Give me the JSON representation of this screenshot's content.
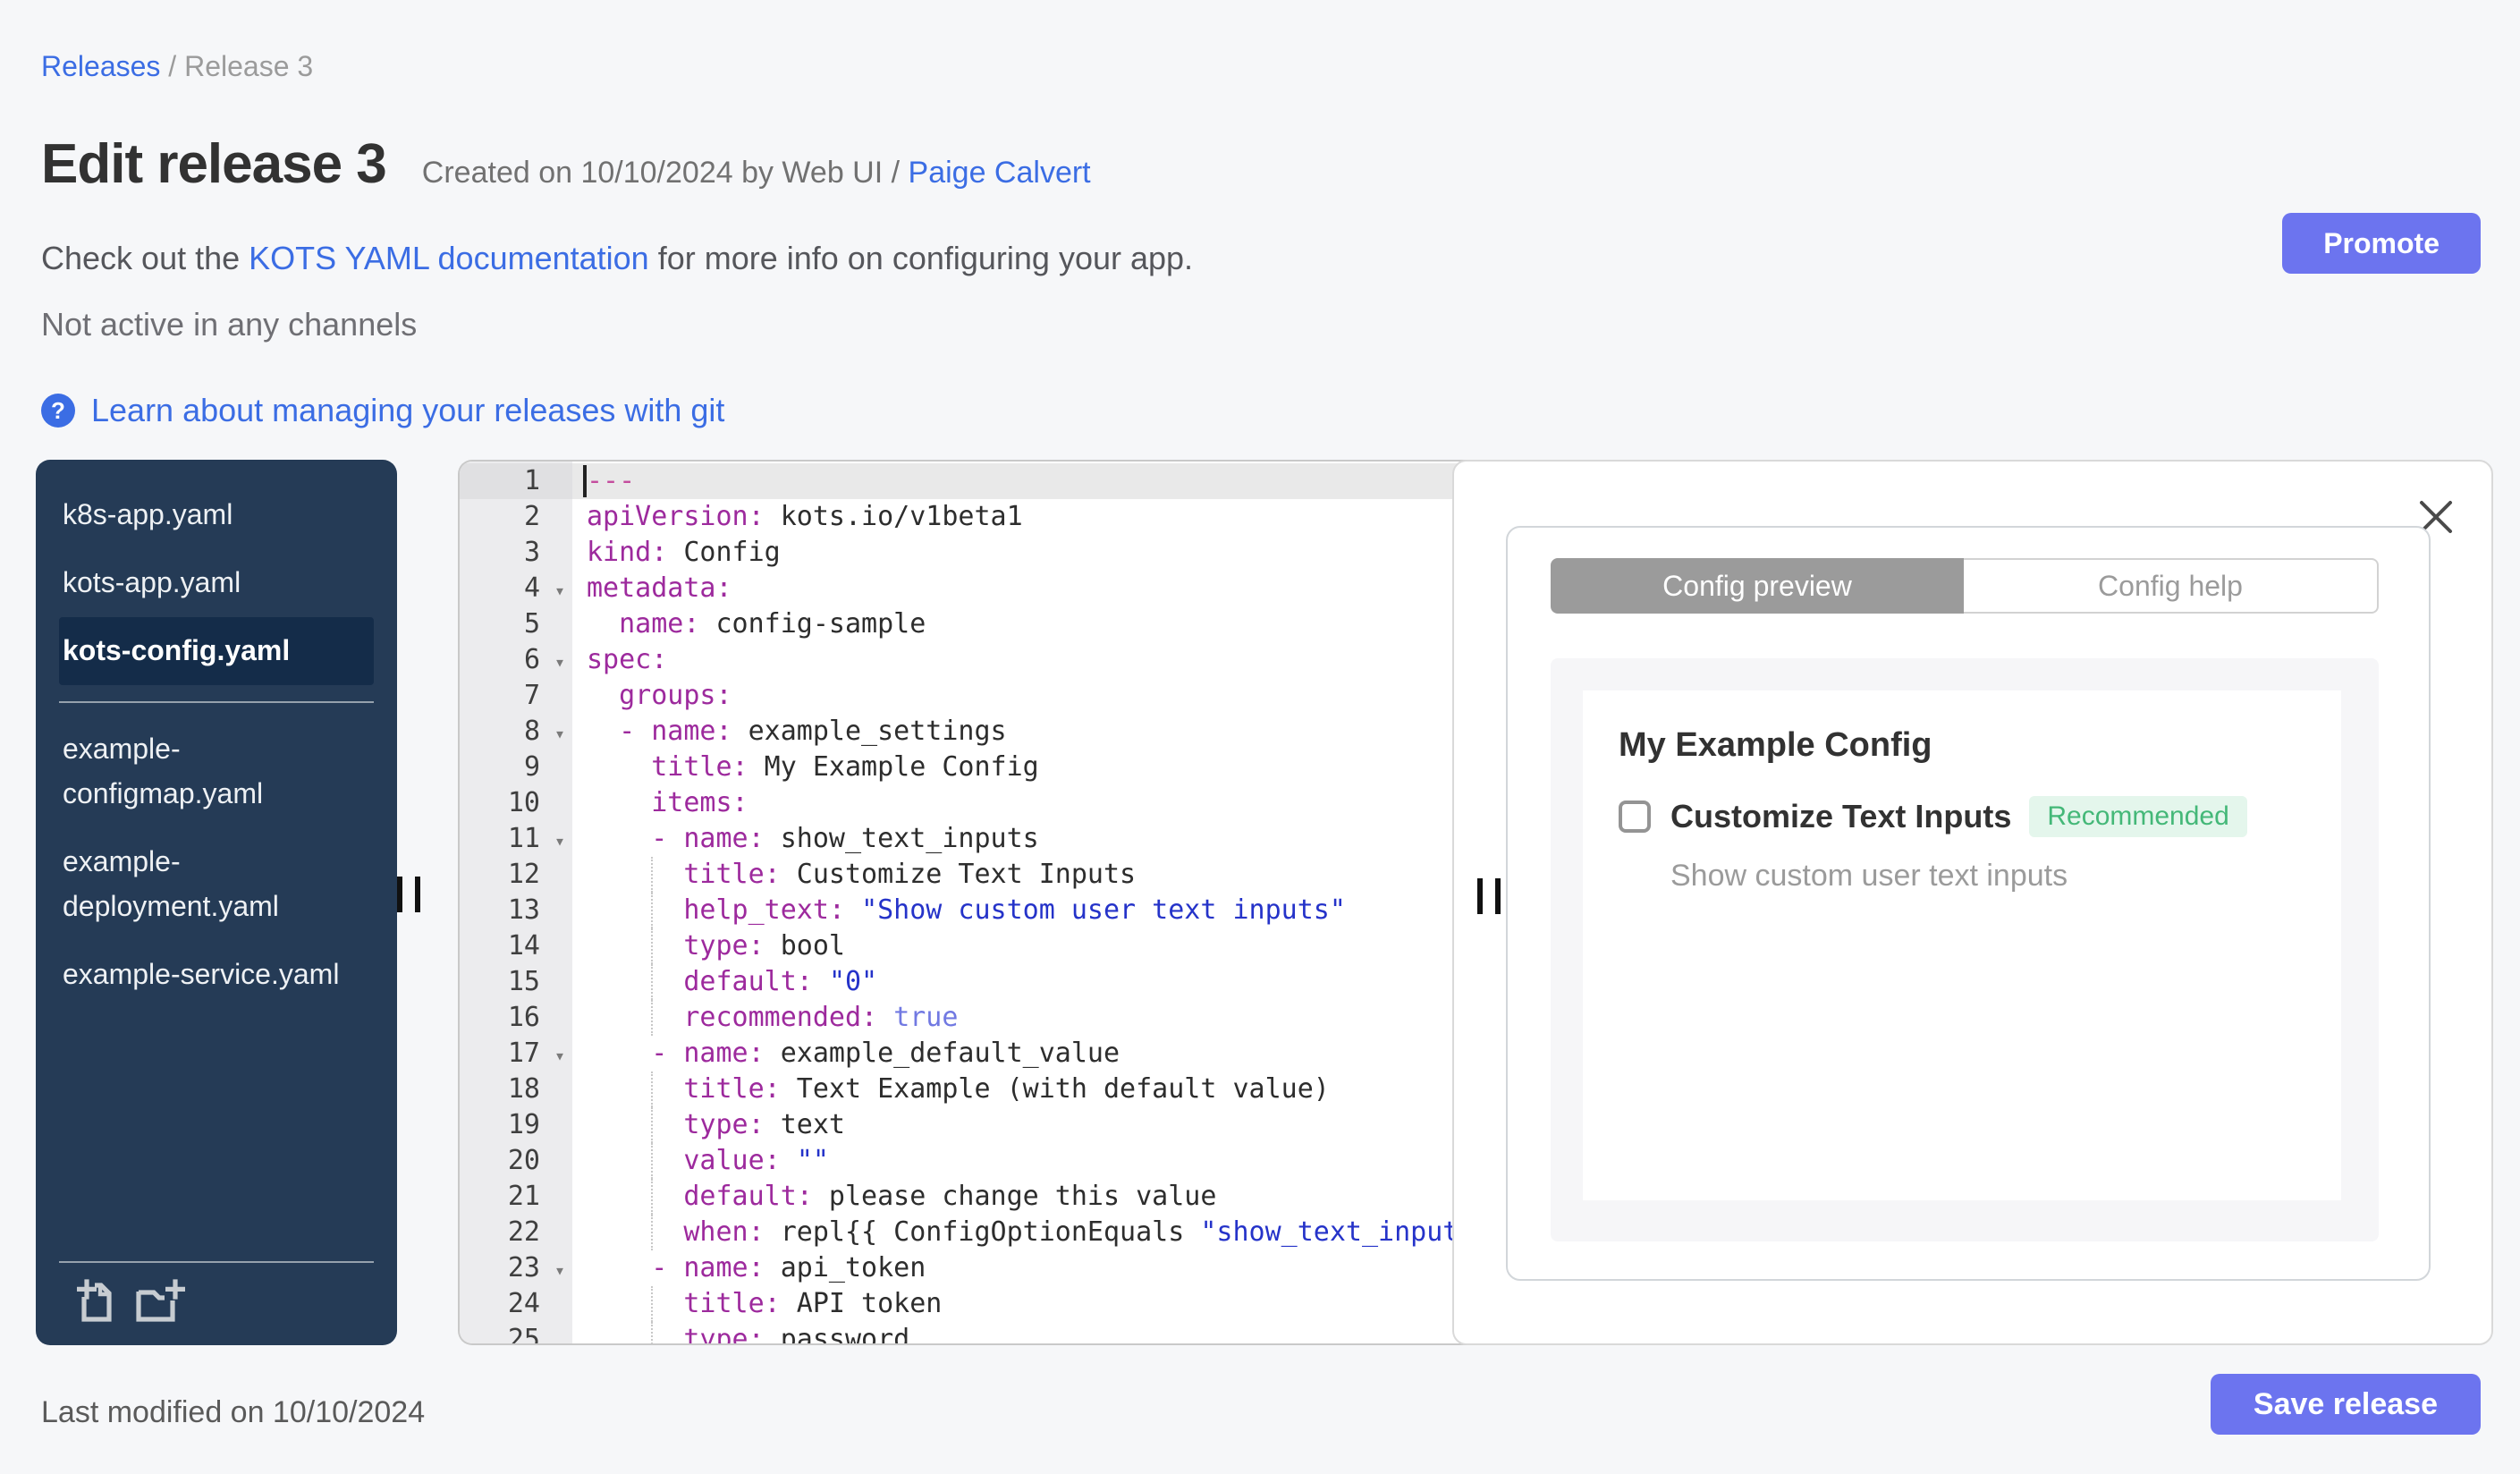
{
  "breadcrumb": {
    "link": "Releases",
    "separator": " / ",
    "current": "Release 3"
  },
  "header": {
    "title": "Edit release 3",
    "created_prefix": "Created on 10/10/2024 by Web UI / ",
    "author_link": "Paige Calvert"
  },
  "promote_label": "Promote",
  "docs_line": {
    "prefix": "Check out the ",
    "link": "KOTS YAML documentation",
    "suffix": " for more info on configuring your app."
  },
  "status_line": "Not active in any channels",
  "git_link": {
    "icon": "?",
    "label": "Learn about managing your releases with git"
  },
  "file_tree": {
    "top": [
      {
        "name": "k8s-app.yaml",
        "selected": false
      },
      {
        "name": "kots-app.yaml",
        "selected": false
      },
      {
        "name": "kots-config.yaml",
        "selected": true
      }
    ],
    "bottom": [
      {
        "name": "example-configmap.yaml",
        "selected": false
      },
      {
        "name": "example-deployment.yaml",
        "selected": false
      },
      {
        "name": "example-service.yaml",
        "selected": false
      }
    ],
    "icons": [
      "add-file-icon",
      "add-folder-icon"
    ]
  },
  "editor": {
    "lines": [
      {
        "num": 1,
        "fold": false,
        "guide": false,
        "active": true,
        "segments": [
          [
            "td",
            "---"
          ]
        ]
      },
      {
        "num": 2,
        "fold": false,
        "guide": false,
        "segments": [
          [
            "tk",
            "apiVersion:"
          ],
          [
            "tv",
            " kots.io/v1beta1"
          ]
        ]
      },
      {
        "num": 3,
        "fold": false,
        "guide": false,
        "segments": [
          [
            "tk",
            "kind:"
          ],
          [
            "tv",
            " Config"
          ]
        ]
      },
      {
        "num": 4,
        "fold": true,
        "guide": false,
        "segments": [
          [
            "tk",
            "metadata:"
          ]
        ]
      },
      {
        "num": 5,
        "fold": false,
        "guide": false,
        "segments": [
          [
            "tv",
            "  "
          ],
          [
            "tk",
            "name:"
          ],
          [
            "tv",
            " config-sample"
          ]
        ]
      },
      {
        "num": 6,
        "fold": true,
        "guide": false,
        "segments": [
          [
            "tk",
            "spec:"
          ]
        ]
      },
      {
        "num": 7,
        "fold": false,
        "guide": false,
        "segments": [
          [
            "tv",
            "  "
          ],
          [
            "tk",
            "groups:"
          ]
        ]
      },
      {
        "num": 8,
        "fold": true,
        "guide": false,
        "segments": [
          [
            "tv",
            "  "
          ],
          [
            "tk",
            "- name:"
          ],
          [
            "tv",
            " example_settings"
          ]
        ]
      },
      {
        "num": 9,
        "fold": false,
        "guide": false,
        "segments": [
          [
            "tv",
            "    "
          ],
          [
            "tk",
            "title:"
          ],
          [
            "tv",
            " My Example Config"
          ]
        ]
      },
      {
        "num": 10,
        "fold": false,
        "guide": false,
        "segments": [
          [
            "tv",
            "    "
          ],
          [
            "tk",
            "items:"
          ]
        ]
      },
      {
        "num": 11,
        "fold": true,
        "guide": false,
        "segments": [
          [
            "tv",
            "    "
          ],
          [
            "tk",
            "- name:"
          ],
          [
            "tv",
            " show_text_inputs"
          ]
        ]
      },
      {
        "num": 12,
        "fold": false,
        "guide": true,
        "segments": [
          [
            "tv",
            "      "
          ],
          [
            "tk",
            "title:"
          ],
          [
            "tv",
            " Customize Text Inputs"
          ]
        ]
      },
      {
        "num": 13,
        "fold": false,
        "guide": true,
        "segments": [
          [
            "tv",
            "      "
          ],
          [
            "tk",
            "help_text:"
          ],
          [
            "tv",
            " "
          ],
          [
            "ts",
            "\"Show custom user text inputs\""
          ]
        ]
      },
      {
        "num": 14,
        "fold": false,
        "guide": true,
        "segments": [
          [
            "tv",
            "      "
          ],
          [
            "tk",
            "type:"
          ],
          [
            "tv",
            " bool"
          ]
        ]
      },
      {
        "num": 15,
        "fold": false,
        "guide": true,
        "segments": [
          [
            "tv",
            "      "
          ],
          [
            "tk",
            "default:"
          ],
          [
            "tv",
            " "
          ],
          [
            "ts",
            "\"0\""
          ]
        ]
      },
      {
        "num": 16,
        "fold": false,
        "guide": true,
        "segments": [
          [
            "tv",
            "      "
          ],
          [
            "tk",
            "recommended:"
          ],
          [
            "tv",
            " "
          ],
          [
            "tb",
            "true"
          ]
        ]
      },
      {
        "num": 17,
        "fold": true,
        "guide": false,
        "segments": [
          [
            "tv",
            "    "
          ],
          [
            "tk",
            "- name:"
          ],
          [
            "tv",
            " example_default_value"
          ]
        ]
      },
      {
        "num": 18,
        "fold": false,
        "guide": true,
        "segments": [
          [
            "tv",
            "      "
          ],
          [
            "tk",
            "title:"
          ],
          [
            "tv",
            " Text Example (with default value)"
          ]
        ]
      },
      {
        "num": 19,
        "fold": false,
        "guide": true,
        "segments": [
          [
            "tv",
            "      "
          ],
          [
            "tk",
            "type:"
          ],
          [
            "tv",
            " text"
          ]
        ]
      },
      {
        "num": 20,
        "fold": false,
        "guide": true,
        "segments": [
          [
            "tv",
            "      "
          ],
          [
            "tk",
            "value:"
          ],
          [
            "tv",
            " "
          ],
          [
            "ts",
            "\"\""
          ]
        ]
      },
      {
        "num": 21,
        "fold": false,
        "guide": true,
        "segments": [
          [
            "tv",
            "      "
          ],
          [
            "tk",
            "default:"
          ],
          [
            "tv",
            " please change this value"
          ]
        ]
      },
      {
        "num": 22,
        "fold": false,
        "guide": true,
        "segments": [
          [
            "tv",
            "      "
          ],
          [
            "tk",
            "when:"
          ],
          [
            "tv",
            " repl{{ ConfigOptionEquals "
          ],
          [
            "ts",
            "\"show_text_inputs\""
          ]
        ]
      },
      {
        "num": 23,
        "fold": true,
        "guide": false,
        "segments": [
          [
            "tv",
            "    "
          ],
          [
            "tk",
            "- name:"
          ],
          [
            "tv",
            " api_token"
          ]
        ]
      },
      {
        "num": 24,
        "fold": false,
        "guide": true,
        "segments": [
          [
            "tv",
            "      "
          ],
          [
            "tk",
            "title:"
          ],
          [
            "tv",
            " API token"
          ]
        ]
      },
      {
        "num": 25,
        "fold": false,
        "guide": true,
        "segments": [
          [
            "tv",
            "      "
          ],
          [
            "tk",
            "type:"
          ],
          [
            "tv",
            " password"
          ]
        ]
      }
    ]
  },
  "preview": {
    "tabs": [
      {
        "label": "Config preview",
        "active": true
      },
      {
        "label": "Config help",
        "active": false
      }
    ],
    "group_title": "My Example Config",
    "item": {
      "label": "Customize Text Inputs",
      "badge": "Recommended",
      "help": "Show custom user text inputs",
      "checked": false
    }
  },
  "footer": {
    "last_modified": "Last modified on 10/10/2024",
    "save_label": "Save release"
  },
  "colors": {
    "accent_blue": "#3b6de4",
    "button_indigo": "#6c74ef",
    "sidebar_bg": "#253b56",
    "badge_green": "#44b878"
  }
}
